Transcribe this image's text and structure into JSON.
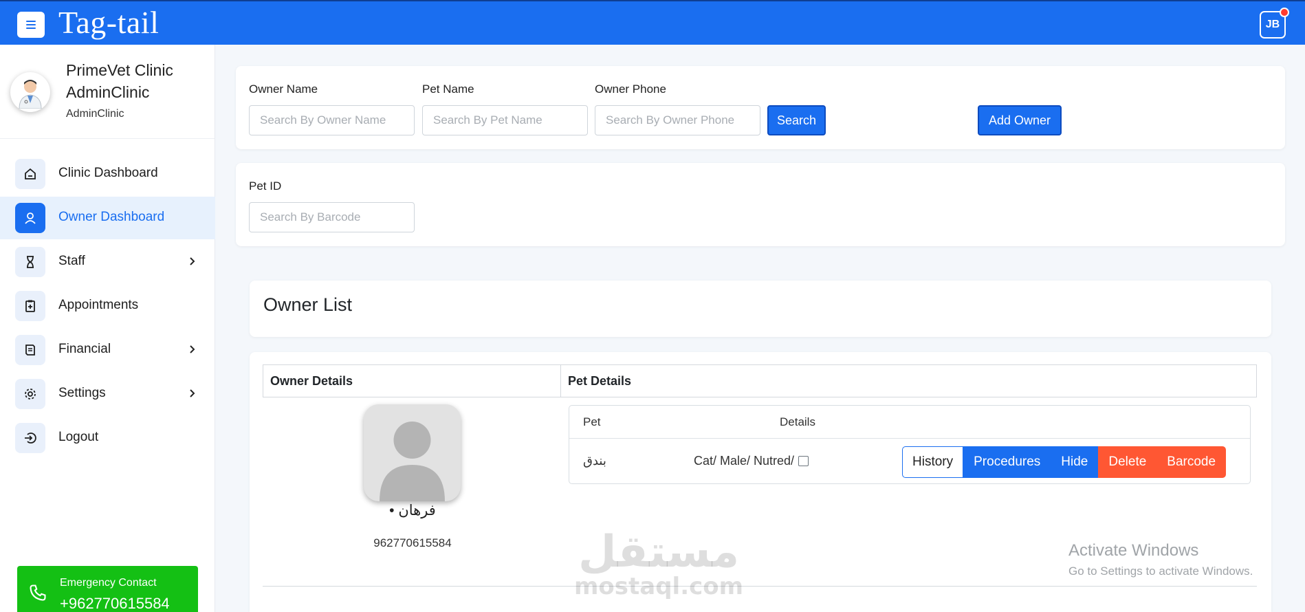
{
  "app": {
    "brand": "Tag-tail",
    "user_initials": "JB"
  },
  "sidebar": {
    "profile": {
      "line1": "PrimeVet Clinic",
      "line2": "AdminClinic",
      "role": "AdminClinic"
    },
    "items": [
      {
        "label": "Clinic Dashboard",
        "icon": "home-icon",
        "active": false,
        "has_chevron": false
      },
      {
        "label": "Owner Dashboard",
        "icon": "user-icon",
        "active": true,
        "has_chevron": false
      },
      {
        "label": "Staff",
        "icon": "hourglass-icon",
        "active": false,
        "has_chevron": true
      },
      {
        "label": "Appointments",
        "icon": "clipboard-plus-icon",
        "active": false,
        "has_chevron": false
      },
      {
        "label": "Financial",
        "icon": "receipt-icon",
        "active": false,
        "has_chevron": true
      },
      {
        "label": "Settings",
        "icon": "gear-icon",
        "active": false,
        "has_chevron": true
      },
      {
        "label": "Logout",
        "icon": "logout-icon",
        "active": false,
        "has_chevron": false
      }
    ],
    "emergency": {
      "label": "Emergency Contact",
      "phone": "+962770615584"
    }
  },
  "search": {
    "owner_name_label": "Owner Name",
    "owner_name_placeholder": "Search By Owner Name",
    "pet_name_label": "Pet Name",
    "pet_name_placeholder": "Search By Pet Name",
    "owner_phone_label": "Owner Phone",
    "owner_phone_placeholder": "Search By Owner Phone",
    "search_button": "Search",
    "add_owner_button": "Add Owner",
    "pet_id_label": "Pet ID",
    "pet_id_placeholder": "Search By Barcode"
  },
  "owner_list": {
    "title": "Owner List",
    "col_owner": "Owner Details",
    "col_pet": "Pet Details",
    "owner": {
      "name": "• فرهان",
      "phone": "962770615584"
    },
    "pet_header": {
      "pet": "Pet",
      "details": "Details"
    },
    "pet": {
      "name": "بندق",
      "details": "Cat/ Male/ Nutred/"
    },
    "actions": {
      "history": "History",
      "procedures": "Procedures",
      "hide": "Hide",
      "delete": "Delete",
      "barcode": "Barcode"
    }
  },
  "watermark": {
    "arabic": "مستقل",
    "latin": "mostaql.com"
  },
  "activation": {
    "title": "Activate Windows",
    "subtitle": "Go to Settings to activate Windows."
  },
  "colors": {
    "primary": "#1a6ef0",
    "danger": "#ff5733",
    "emergency": "#14c014"
  }
}
